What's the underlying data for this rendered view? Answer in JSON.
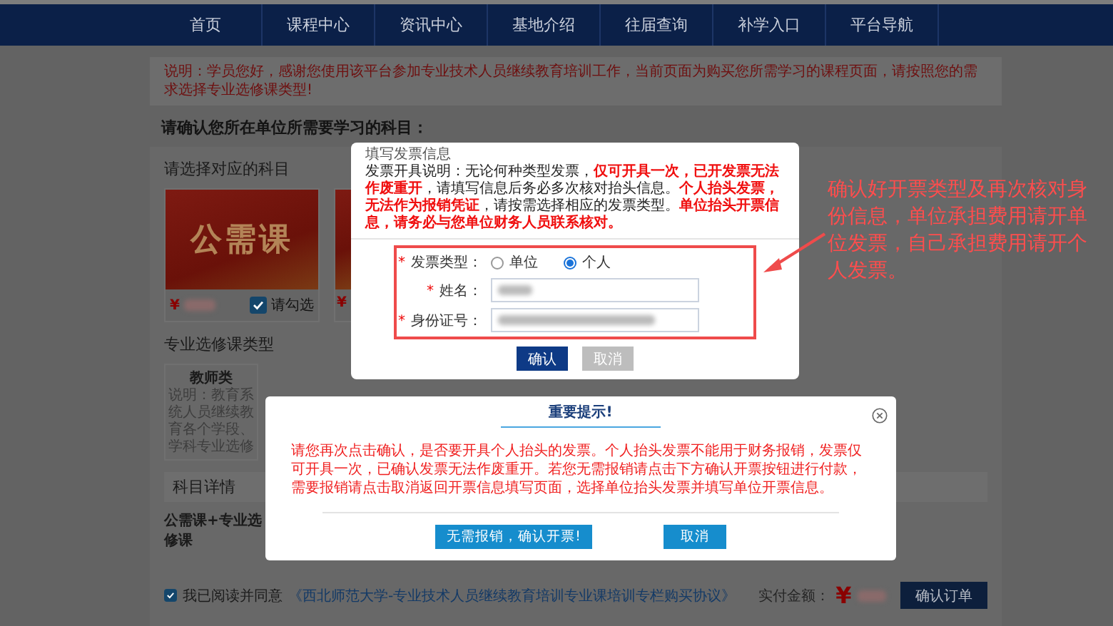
{
  "nav": [
    {
      "label": "首页"
    },
    {
      "label": "课程中心"
    },
    {
      "label": "资讯中心"
    },
    {
      "label": "基地介绍"
    },
    {
      "label": "往届查询"
    },
    {
      "label": "补学入口"
    },
    {
      "label": "平台导航"
    }
  ],
  "notice": "说明：学员您好，感谢您使用该平台参加专业技术人员继续教育培训工作，当前页面为购买您所需学习的课程页面，请按照您的需求选择专业选修课类型!",
  "prompt": "请确认您所在单位所需要学习的科目：",
  "subjects": {
    "title": "请选择对应的科目",
    "cards": [
      {
        "banner": "公需课",
        "currency": "¥",
        "checkbox_label": "请勾选",
        "checked": true
      },
      {
        "currency": "¥"
      }
    ]
  },
  "elective": {
    "title": "专业选修课类型",
    "cards": [
      {
        "name": "教师类",
        "description": "说明：教育系统人员继续教育各个学段、学科专业选修"
      }
    ]
  },
  "details": {
    "title": "科目详情",
    "subtitle": "公需课+专业选修课"
  },
  "footer": {
    "agree_checked": true,
    "agree_label": "我已阅读并同意",
    "agreement_link": "《西北师范大学-专业技术人员继续教育培训专业课培训专栏购买协议》",
    "amount_label": "实付金额：",
    "currency": "¥",
    "submit": "确认订单"
  },
  "invoice_dialog": {
    "title": "填写发票信息",
    "description": "发票开具说明：无论何种类型发票，**仅可开具一次，已开发票无法作废重开**，请填写信息后务必多次核对抬头信息。**个人抬头发票，无法作为报销凭证**，请按需选择相应的发票类型。**单位抬头开票信息，请务必与您单位财务人员联系核对。**",
    "fields": [
      {
        "kind": "radio",
        "mark": "*",
        "label": "发票类型：",
        "options": [
          {
            "label": "单位",
            "selected": false
          },
          {
            "label": "个人",
            "selected": true
          }
        ]
      },
      {
        "kind": "text",
        "mark": "*",
        "label": "姓名："
      },
      {
        "kind": "text",
        "mark": "*",
        "label": "身份证号："
      }
    ],
    "buttons": [
      {
        "label": "确认",
        "disabled": false
      },
      {
        "label": "取消",
        "disabled": true
      }
    ]
  },
  "alert_dialog": {
    "title": "重要提示!",
    "message": "请您再次点击确认，是否要开具个人抬头的发票。个人抬头发票不能用于财务报销，发票仅可开具一次，已确认发票无法作废重开。若您无需报销请点击下方确认开票按钮进行付款，需要报销请点击取消返回开票信息填写页面，选择单位抬头发票并填写单位开票信息。",
    "buttons": [
      {
        "label": "无需报销，确认开票!"
      },
      {
        "label": "取消"
      }
    ]
  },
  "annotation": {
    "text": "确认好开票类型及再次核对身份信息，单位承担费用请开单位发票，自己承担费用请开个人发票。"
  }
}
